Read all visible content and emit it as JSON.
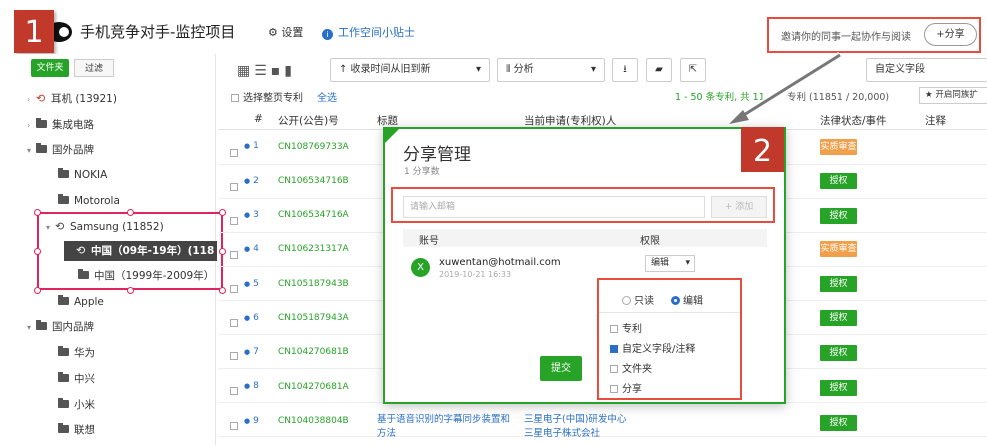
{
  "header": {
    "title": "手机竞争对手-监控项目",
    "settings": "设置",
    "tips": "工作空间小贴士",
    "invite": "邀请你的同事一起协作与阅读",
    "share": "+分享"
  },
  "badges": {
    "one": "1",
    "two": "2"
  },
  "sidebar": {
    "tabs": [
      "文件夹",
      "过滤"
    ],
    "items": [
      {
        "label": "耳机 (13921)"
      },
      {
        "label": "集成电路"
      },
      {
        "label": "国外品牌"
      },
      {
        "label": "NOKIA"
      },
      {
        "label": "Motorola"
      },
      {
        "label": "Samsung (11852)"
      },
      {
        "label": "中国（09年-19年）(118"
      },
      {
        "label": "中国（1999年-2009年）"
      },
      {
        "label": "Apple"
      },
      {
        "label": "国内品牌"
      },
      {
        "label": "华为"
      },
      {
        "label": "中兴"
      },
      {
        "label": "小米"
      },
      {
        "label": "联想"
      }
    ]
  },
  "toolbar": {
    "sort": "↑ 收录时间从旧到新",
    "analyze": "分析",
    "custom": "自定义字段",
    "selectAll": "选择整页专利",
    "all": "全选",
    "pagination": "1 - 50 条专利, 共 11",
    "count": "专利 (11851 / 20,000)",
    "family": "开启同族扩"
  },
  "table": {
    "headers": [
      "#",
      "公开(公告)号",
      "标题",
      "当前申请(专利权)人",
      "法律状态/事件",
      "注释"
    ],
    "rows": [
      {
        "n": "1",
        "pub": "CN108769733A",
        "status": "实质审查"
      },
      {
        "n": "2",
        "pub": "CN106534716B",
        "status": "授权"
      },
      {
        "n": "3",
        "pub": "CN106534716A",
        "status": "授权"
      },
      {
        "n": "4",
        "pub": "CN106231317A",
        "status": "实质审查"
      },
      {
        "n": "5",
        "pub": "CN105187943B",
        "status": "授权"
      },
      {
        "n": "6",
        "pub": "CN105187943A",
        "status": "授权"
      },
      {
        "n": "7",
        "pub": "CN104270681B",
        "status": "授权"
      },
      {
        "n": "8",
        "pub": "CN104270681A",
        "status": "授权"
      },
      {
        "n": "9",
        "pub": "CN104038804B",
        "status": "授权",
        "title1": "基于语音识别的字幕同步装置和",
        "title2": "方法",
        "app1": "三星电子(中国)研发中心",
        "app2": "三星电子株式会社"
      }
    ]
  },
  "modal": {
    "title": "分享管理",
    "subtitle": "1 分享数",
    "placeholder": "请输入邮箱",
    "add": "+ 添加",
    "accountHeader": "账号",
    "permHeader": "权限",
    "avatar": "X",
    "email": "xuwentan@hotmail.com",
    "date": "2019-10-21 16:33",
    "permSelect": "编辑",
    "readOnly": "只读",
    "edit": "编辑",
    "options": [
      "专利",
      "自定义字段/注释",
      "文件夹",
      "分享"
    ],
    "submit": "提交"
  },
  "colors": {
    "green": "#27a327",
    "red": "#e74c3c",
    "blue": "#2a6fc6",
    "orange": "#f0a04b"
  }
}
